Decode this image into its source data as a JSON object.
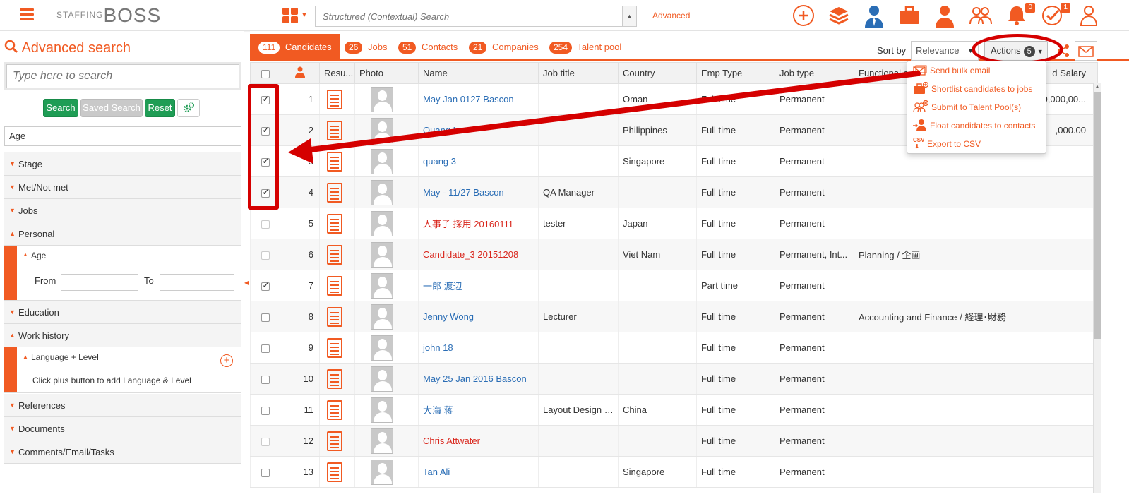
{
  "app": {
    "logo_part1": "STAFFING",
    "logo_part2": "BOSS"
  },
  "topbar": {
    "search_placeholder": "Structured (Contextual) Search",
    "advanced_link": "Advanced",
    "notifications_badge": "0",
    "tasks_badge": "1"
  },
  "left": {
    "title": "Advanced search",
    "search_placeholder": "Type here to search",
    "search_button": "Search",
    "saved_search_button": "Saved Search",
    "reset_button": "Reset",
    "filter_value": "Age",
    "sections": {
      "stage": "Stage",
      "met": "Met/Not met",
      "jobs": "Jobs",
      "personal": "Personal",
      "age": "Age",
      "from": "From",
      "to": "To",
      "education": "Education",
      "work_history": "Work history",
      "language_level": "Language + Level",
      "language_hint": "Click plus button to add Language & Level",
      "references": "References",
      "documents": "Documents",
      "comments": "Comments/Email/Tasks"
    }
  },
  "tabs": {
    "candidates_count": "111",
    "candidates": "Candidates",
    "jobs_count": "26",
    "jobs": "Jobs",
    "contacts_count": "51",
    "contacts": "Contacts",
    "companies_count": "21",
    "companies": "Companies",
    "talent_count": "254",
    "talent": "Talent pool"
  },
  "toolbar": {
    "sort_by": "Sort by",
    "sort_value": "Relevance",
    "actions": "Actions",
    "actions_count": "5"
  },
  "actions_menu": {
    "send_bulk_email": "Send bulk email",
    "shortlist": "Shortlist candidates to jobs",
    "talent_pool": "Submit to Talent Pool(s)",
    "float": "Float candidates to contacts",
    "csv_icon": "CSV",
    "export_csv": "Export to CSV"
  },
  "table": {
    "headers": {
      "resume": "Resu...",
      "photo": "Photo",
      "name": "Name",
      "job_title": "Job title",
      "country": "Country",
      "emp_type": "Emp Type",
      "job_type": "Job type",
      "functional": "Functional a...",
      "salary": "d Salary"
    },
    "rows": [
      {
        "num": "1",
        "name": "May Jan 0127 Bascon",
        "job_title": "",
        "country": "Oman",
        "emp": "Full time",
        "jtype": "Permanent",
        "func": "",
        "salary": "20,000,00..."
      },
      {
        "num": "2",
        "name": "Quang Lam",
        "job_title": "",
        "country": "Philippines",
        "emp": "Full time",
        "jtype": "Permanent",
        "func": "",
        "salary": ",000.00"
      },
      {
        "num": "3",
        "name": "quang 3",
        "job_title": "",
        "country": "Singapore",
        "emp": "Full time",
        "jtype": "Permanent",
        "func": "",
        "salary": ""
      },
      {
        "num": "4",
        "name": "May - 11/27 Bascon",
        "job_title": "QA Manager",
        "country": "",
        "emp": "Full time",
        "jtype": "Permanent",
        "func": "",
        "salary": ""
      },
      {
        "num": "5",
        "name": "人事子 採用 20160111",
        "job_title": "tester",
        "country": "Japan",
        "emp": "Full time",
        "jtype": "Permanent",
        "func": "",
        "salary": ""
      },
      {
        "num": "6",
        "name": "Candidate_3 20151208",
        "job_title": "",
        "country": "Viet Nam",
        "emp": "Full time",
        "jtype": "Permanent, Int...",
        "func": "Planning / 企画",
        "salary": ""
      },
      {
        "num": "7",
        "name": "一郎 渡辺",
        "job_title": "",
        "country": "",
        "emp": "Part time",
        "jtype": "Permanent",
        "func": "",
        "salary": ""
      },
      {
        "num": "8",
        "name": "Jenny Wong",
        "job_title": "Lecturer",
        "country": "",
        "emp": "Full time",
        "jtype": "Permanent",
        "func": "Accounting and Finance / 経理･財務",
        "salary": ""
      },
      {
        "num": "9",
        "name": "john 18",
        "job_title": "",
        "country": "",
        "emp": "Full time",
        "jtype": "Permanent",
        "func": "",
        "salary": ""
      },
      {
        "num": "10",
        "name": "May 25 Jan 2016 Bascon",
        "job_title": "",
        "country": "",
        "emp": "Full time",
        "jtype": "Permanent",
        "func": "",
        "salary": ""
      },
      {
        "num": "11",
        "name": "大海 蒋",
        "job_title": "Layout Design E...",
        "country": "China",
        "emp": "Full time",
        "jtype": "Permanent",
        "func": "",
        "salary": ""
      },
      {
        "num": "12",
        "name": "Chris Attwater",
        "job_title": "",
        "country": "",
        "emp": "Full time",
        "jtype": "Permanent",
        "func": "",
        "salary": ""
      },
      {
        "num": "13",
        "name": "Tan Ali",
        "job_title": "",
        "country": "Singapore",
        "emp": "Full time",
        "jtype": "Permanent",
        "func": "",
        "salary": ""
      }
    ]
  }
}
